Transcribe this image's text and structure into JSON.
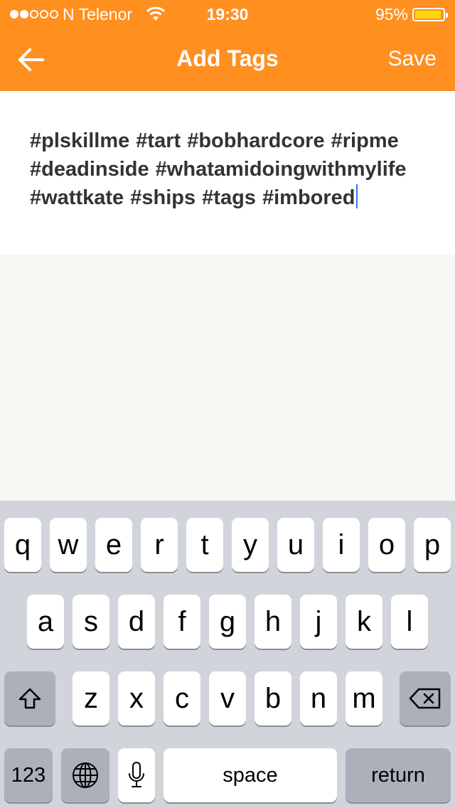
{
  "status_bar": {
    "carrier": "N Telenor",
    "time": "19:30",
    "battery_percent": "95%",
    "battery_level": 0.95,
    "signal_bars_filled": 2,
    "signal_bars_total": 5
  },
  "nav": {
    "title": "Add Tags",
    "save_label": "Save",
    "back_icon": "arrow-left-icon"
  },
  "editor": {
    "text": "#plskillme #tart #bobhardcore #ripme #deadinside #whatamidoingwithmylife #wattkate #ships #tags #imbored"
  },
  "keyboard": {
    "row1": [
      "q",
      "w",
      "e",
      "r",
      "t",
      "y",
      "u",
      "i",
      "o",
      "p"
    ],
    "row2": [
      "a",
      "s",
      "d",
      "f",
      "g",
      "h",
      "j",
      "k",
      "l"
    ],
    "row3": [
      "z",
      "x",
      "c",
      "v",
      "b",
      "n",
      "m"
    ],
    "numbers_label": "123",
    "space_label": "space",
    "return_label": "return",
    "shift_icon": "shift-icon",
    "delete_icon": "delete-icon",
    "globe_icon": "globe-icon",
    "mic_icon": "microphone-icon"
  },
  "colors": {
    "header": "#ff8f1f",
    "caret": "#3478f6",
    "battery": "#ffd60a"
  }
}
